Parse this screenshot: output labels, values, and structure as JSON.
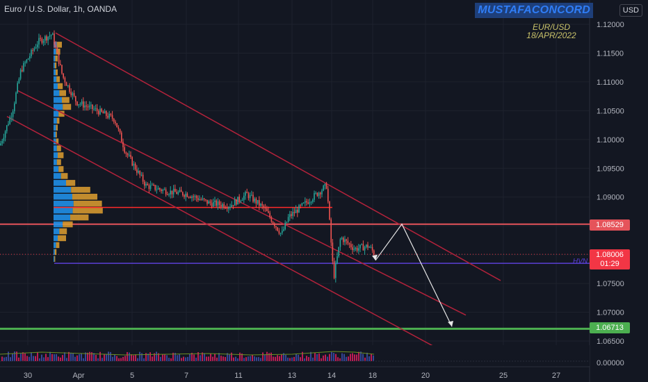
{
  "header": {
    "symbol_title": "Euro / U.S. Dollar, 1h, OANDA",
    "watermark": "MUSTAFACONCORD",
    "currency": "USD",
    "note_pair": "EUR/USD",
    "note_date": "18/APR/2022"
  },
  "chart_data": {
    "type": "line",
    "title": "Euro / U.S. Dollar, 1h, OANDA",
    "xlabel": "",
    "ylabel": "",
    "x_ticks": [
      "30",
      "Apr",
      "5",
      "7",
      "11",
      "13",
      "14",
      "18",
      "20",
      "25",
      "27"
    ],
    "y_ticks": [
      "1.12000",
      "1.11500",
      "1.11000",
      "1.10500",
      "1.10000",
      "1.09500",
      "1.09000",
      "1.08500",
      "1.08000",
      "1.07500",
      "1.07000",
      "1.06500"
    ],
    "ylim": [
      1.0635,
      1.1213
    ],
    "volume_axis_label": "0.00000",
    "series": [
      {
        "values": [
          {
            "x": "30",
            "y": 1.099
          },
          {
            "x": "30",
            "y": 1.105
          },
          {
            "x": "31",
            "y": 1.112
          },
          {
            "x": "31",
            "y": 1.117
          },
          {
            "x": "31",
            "y": 1.1183
          },
          {
            "x": "Apr",
            "y": 1.111
          },
          {
            "x": "Apr",
            "y": 1.1065
          },
          {
            "x": "4",
            "y": 1.105
          },
          {
            "x": "4",
            "y": 1.1035
          },
          {
            "x": "5",
            "y": 1.098
          },
          {
            "x": "5",
            "y": 1.092
          },
          {
            "x": "6",
            "y": 1.091
          },
          {
            "x": "7",
            "y": 1.0905
          },
          {
            "x": "8",
            "y": 1.089
          },
          {
            "x": "11",
            "y": 1.0885
          },
          {
            "x": "11",
            "y": 1.0905
          },
          {
            "x": "12",
            "y": 1.088
          },
          {
            "x": "13",
            "y": 1.0835
          },
          {
            "x": "13",
            "y": 1.0865
          },
          {
            "x": "13",
            "y": 1.089
          },
          {
            "x": "14",
            "y": 1.092
          },
          {
            "x": "14",
            "y": 1.076
          },
          {
            "x": "14",
            "y": 1.083
          },
          {
            "x": "15",
            "y": 1.081
          },
          {
            "x": "18",
            "y": 1.0815
          },
          {
            "x": "18",
            "y": 1.08
          }
        ]
      }
    ],
    "price_tags": [
      {
        "value": "1.08529",
        "color": "#e5535a"
      },
      {
        "value": "1.08006",
        "color": "#f23645"
      },
      {
        "value": "1.06713",
        "color": "#4caf50"
      }
    ],
    "countdown": "01:29",
    "horizontal_levels": [
      {
        "price": 1.08529,
        "color": "#e5535a"
      },
      {
        "price": 1.06713,
        "color": "#4caf50"
      },
      {
        "price": 1.0785,
        "color": "#5b3fd6",
        "label": "HVN"
      }
    ],
    "poc_price": 1.0882,
    "volume_profile": [
      {
        "price": 1.1164,
        "up": 8,
        "down": 12
      },
      {
        "price": 1.1152,
        "up": 6,
        "down": 10
      },
      {
        "price": 1.114,
        "up": 4,
        "down": 6
      },
      {
        "price": 1.1128,
        "up": 3,
        "down": 4
      },
      {
        "price": 1.1116,
        "up": 5,
        "down": 5
      },
      {
        "price": 1.1104,
        "up": 7,
        "down": 8
      },
      {
        "price": 1.1092,
        "up": 10,
        "down": 12
      },
      {
        "price": 1.108,
        "up": 14,
        "down": 16
      },
      {
        "price": 1.1068,
        "up": 20,
        "down": 18
      },
      {
        "price": 1.1056,
        "up": 22,
        "down": 20
      },
      {
        "price": 1.1044,
        "up": 12,
        "down": 14
      },
      {
        "price": 1.1032,
        "up": 8,
        "down": 6
      },
      {
        "price": 1.102,
        "up": 6,
        "down": 4
      },
      {
        "price": 1.1008,
        "up": 5,
        "down": 3
      },
      {
        "price": 1.0996,
        "up": 6,
        "down": 6
      },
      {
        "price": 1.0984,
        "up": 8,
        "down": 10
      },
      {
        "price": 1.0972,
        "up": 10,
        "down": 14
      },
      {
        "price": 1.096,
        "up": 8,
        "down": 10
      },
      {
        "price": 1.0948,
        "up": 12,
        "down": 12
      },
      {
        "price": 1.0936,
        "up": 18,
        "down": 16
      },
      {
        "price": 1.0924,
        "up": 30,
        "down": 22
      },
      {
        "price": 1.0912,
        "up": 42,
        "down": 46
      },
      {
        "price": 1.09,
        "up": 45,
        "down": 60
      },
      {
        "price": 1.0888,
        "up": 48,
        "down": 68
      },
      {
        "price": 1.0876,
        "up": 46,
        "down": 72
      },
      {
        "price": 1.0864,
        "up": 40,
        "down": 44
      },
      {
        "price": 1.0852,
        "up": 22,
        "down": 24
      },
      {
        "price": 1.084,
        "up": 14,
        "down": 18
      },
      {
        "price": 1.0828,
        "up": 10,
        "down": 20
      },
      {
        "price": 1.0816,
        "up": 6,
        "down": 8
      },
      {
        "price": 1.0804,
        "up": 3,
        "down": 4
      },
      {
        "price": 1.0792,
        "up": 2,
        "down": 2
      }
    ]
  },
  "colors": {
    "background": "#131722",
    "grid": "#1e222d",
    "up": "#26a69a",
    "down": "#ef5350",
    "channel": "#b2223b",
    "profile_up": "#2196f3",
    "profile_down": "#e0a030",
    "arrow": "#e6e6e6"
  }
}
